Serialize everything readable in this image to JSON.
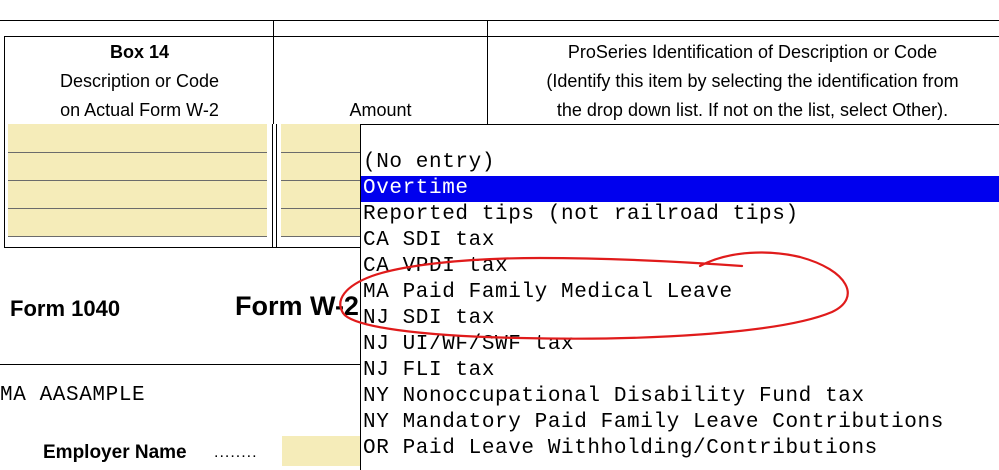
{
  "box14": {
    "header": {
      "title": "Box 14",
      "line1": "Description or Code",
      "line2": "on Actual Form W-2"
    },
    "amount_header": "Amount",
    "proseries_header": {
      "line1": "ProSeries Identification of Description or Code",
      "line2": "(Identify this item by selecting the identification from",
      "line3": "the drop down list. If not on the list, select Other)."
    }
  },
  "dropdown": {
    "items": [
      {
        "label": "(No entry)",
        "selected": false
      },
      {
        "label": "Overtime",
        "selected": true
      },
      {
        "label": "Reported tips (not railroad tips)",
        "selected": false
      },
      {
        "label": "CA SDI tax",
        "selected": false
      },
      {
        "label": "CA VPDI tax",
        "selected": false
      },
      {
        "label": "MA Paid Family Medical Leave",
        "selected": false
      },
      {
        "label": "NJ SDI tax",
        "selected": false
      },
      {
        "label": "NJ UI/WF/SWF tax",
        "selected": false
      },
      {
        "label": "NJ FLI tax",
        "selected": false
      },
      {
        "label": "NY Nonoccupational Disability Fund tax",
        "selected": false
      },
      {
        "label": "NY Mandatory Paid Family Leave Contributions",
        "selected": false
      },
      {
        "label": "OR Paid Leave Withholding/Contributions",
        "selected": false
      }
    ],
    "highlight_color": "#0000ee",
    "annotation_color": "#e01b1b"
  },
  "form": {
    "form_1040": "Form 1040",
    "form_w2": "Form W-2",
    "client": "MA AASAMPLE",
    "employer_label": "Employer Name",
    "employer_dots": "........"
  },
  "colors": {
    "input_fill": "#f5ecb9"
  }
}
